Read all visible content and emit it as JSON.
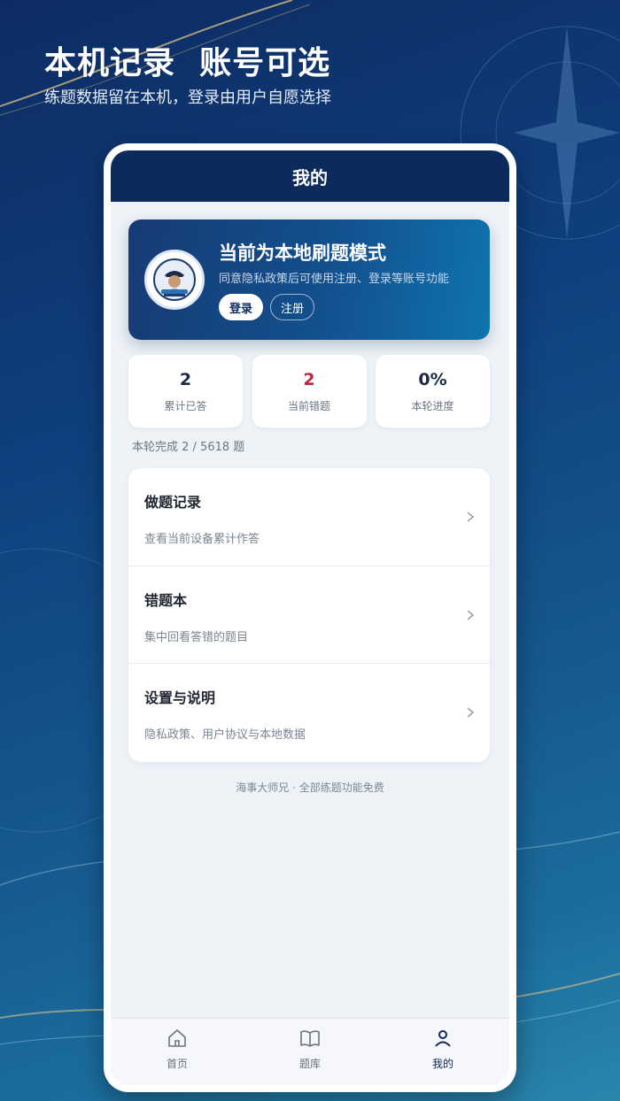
{
  "promo": {
    "title": "本机记录  账号可选",
    "subtitle": "练题数据留在本机，登录由用户自愿选择"
  },
  "app": {
    "nav_title": "我的"
  },
  "profile": {
    "title": "当前为本地刷题模式",
    "description": "同意隐私政策后可使用注册、登录等账号功能",
    "login_label": "登录",
    "register_label": "注册"
  },
  "stats": [
    {
      "value": "2",
      "label": "累计已答",
      "color": "#1b2a44"
    },
    {
      "value": "2",
      "label": "当前错题",
      "color": "#b8293b"
    },
    {
      "value": "0%",
      "label": "本轮进度",
      "color": "#1b2a44"
    }
  ],
  "progress_text": "本轮完成 2 / 5618 题",
  "menu": [
    {
      "title": "做题记录",
      "desc": "查看当前设备累计作答"
    },
    {
      "title": "错题本",
      "desc": "集中回看答错的题目"
    },
    {
      "title": "设置与说明",
      "desc": "隐私政策、用户协议与本地数据"
    }
  ],
  "footer": "海事大师兄 · 全部练题功能免费",
  "tabs": [
    {
      "label": "首页",
      "icon": "home-icon"
    },
    {
      "label": "题库",
      "icon": "book-icon"
    },
    {
      "label": "我的",
      "icon": "person-icon",
      "active": true
    }
  ],
  "colors": {
    "nav": "#0c2b5c",
    "accent_red": "#b8293b"
  }
}
